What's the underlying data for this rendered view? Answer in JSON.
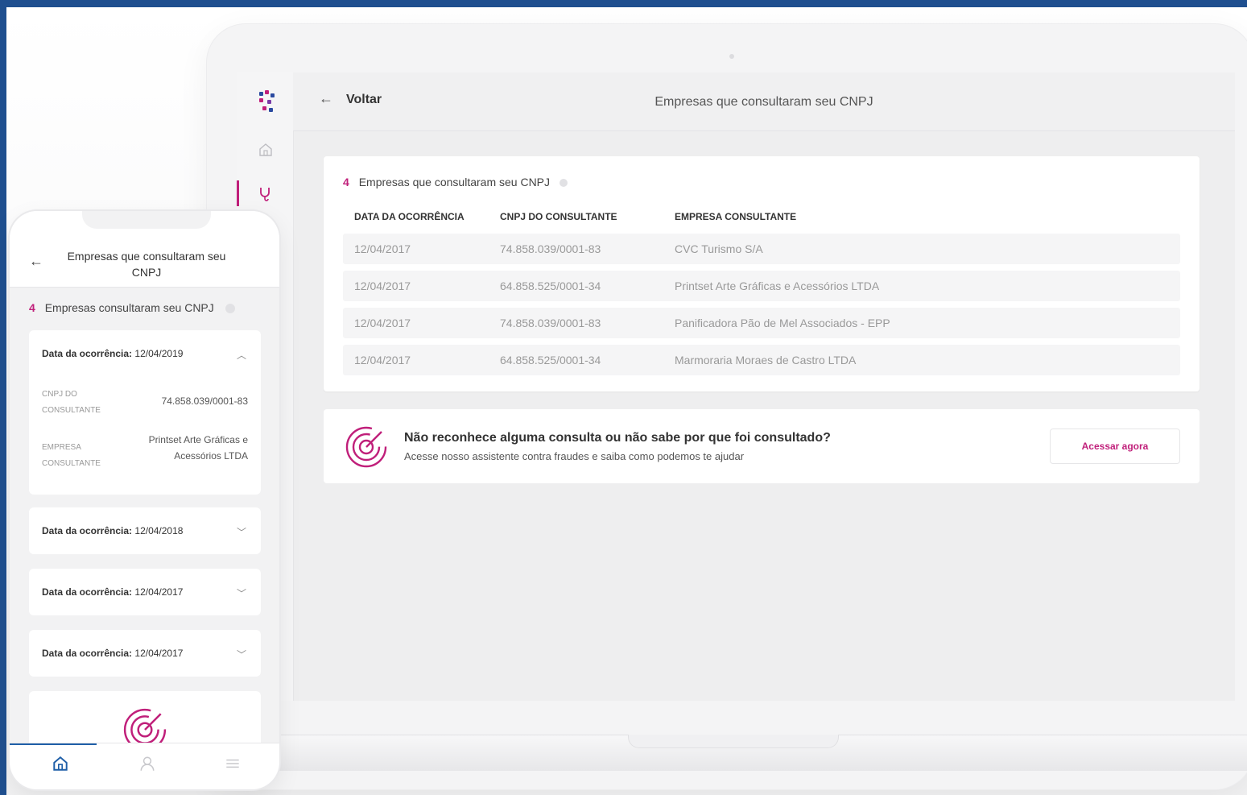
{
  "desktop": {
    "topbar": {
      "back_label": "Voltar",
      "title": "Empresas que consultaram seu CNPJ"
    },
    "card": {
      "count": "4",
      "heading": "Empresas que consultaram seu CNPJ",
      "columns": [
        "DATA DA OCORRÊNCIA",
        "CNPJ DO CONSULTANTE",
        "EMPRESA CONSULTANTE"
      ],
      "rows": [
        [
          "12/04/2017",
          "74.858.039/0001-83",
          "CVC Turismo S/A"
        ],
        [
          "12/04/2017",
          "64.858.525/0001-34",
          "Printset Arte Gráficas e Acessórios LTDA"
        ],
        [
          "12/04/2017",
          "74.858.039/0001-83",
          "Panificadora Pão de Mel Associados - EPP"
        ],
        [
          "12/04/2017",
          "64.858.525/0001-34",
          "Marmoraria Moraes de Castro LTDA"
        ]
      ]
    },
    "alert": {
      "title": "Não reconhece alguma consulta ou não sabe por que foi consultado?",
      "subtitle": "Acesse nosso assistente contra fraudes e saiba como podemos te ajudar",
      "button": "Acessar agora"
    },
    "colors": {
      "accent": "#c01f7a",
      "frame": "#1f4f8f"
    },
    "icons": [
      "logo-icon",
      "home-icon",
      "stethoscope-icon",
      "back-arrow-icon",
      "target-icon",
      "info-icon"
    ]
  },
  "mobile": {
    "title": "Empresas que consultaram seu CNPJ",
    "count": "4",
    "heading": "Empresas consultaram seu CNPJ",
    "date_label": "Data da ocorrência:",
    "expanded": {
      "date": "12/04/2019",
      "cnpj_label": "CNPJ DO CONSULTANTE",
      "cnpj_value": "74.858.039/0001-83",
      "empresa_label": "EMPRESA CONSULTANTE",
      "empresa_value": "Printset Arte Gráficas e Acessórios LTDA"
    },
    "collapsed_dates": [
      "12/04/2018",
      "12/04/2017",
      "12/04/2017"
    ],
    "icons": [
      "back-arrow-icon",
      "info-icon",
      "chevron-up-icon",
      "chevron-down-icon",
      "target-icon",
      "home-icon",
      "user-icon",
      "menu-icon"
    ]
  }
}
